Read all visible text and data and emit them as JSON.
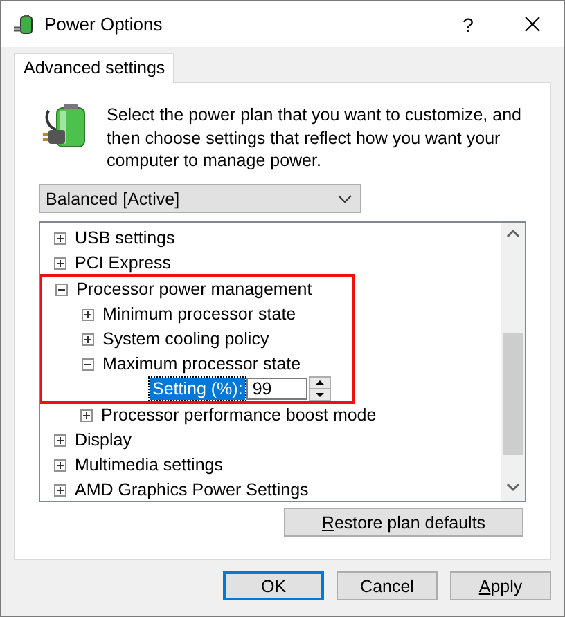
{
  "window": {
    "title": "Power Options",
    "help": "?"
  },
  "tabs": [
    {
      "label": "Advanced settings",
      "selected": true
    }
  ],
  "description": "Select the power plan that you want to customize, and then choose settings that reflect how you want your computer to manage power.",
  "plan_select": {
    "value": "Balanced [Active]"
  },
  "tree": [
    {
      "kind": "node",
      "label": "USB settings",
      "expanded": false
    },
    {
      "kind": "node",
      "label": "PCI Express",
      "expanded": false
    },
    {
      "kind": "node",
      "label": "Processor power management",
      "expanded": true,
      "highlighted": true,
      "children": [
        {
          "kind": "node",
          "label": "Minimum processor state",
          "expanded": false
        },
        {
          "kind": "node",
          "label": "System cooling policy",
          "expanded": false
        },
        {
          "kind": "node",
          "label": "Maximum processor state",
          "expanded": true,
          "children": [
            {
              "kind": "setting",
              "label": "Setting (%):",
              "value": "99",
              "selected": true
            }
          ]
        }
      ]
    },
    {
      "kind": "node",
      "label": "Processor performance boost mode",
      "expanded": false,
      "indented": true
    },
    {
      "kind": "node",
      "label": "Display",
      "expanded": false
    },
    {
      "kind": "node",
      "label": "Multimedia settings",
      "expanded": false
    },
    {
      "kind": "node",
      "label": "AMD Graphics Power Settings",
      "expanded": false
    }
  ],
  "restore_button": {
    "label": "Restore plan defaults",
    "mnemonic": true
  },
  "buttons": [
    {
      "label": "OK",
      "default": true,
      "mnemonic": false
    },
    {
      "label": "Cancel",
      "default": false,
      "mnemonic": false
    },
    {
      "label": "Apply",
      "default": false,
      "mnemonic": true
    }
  ]
}
